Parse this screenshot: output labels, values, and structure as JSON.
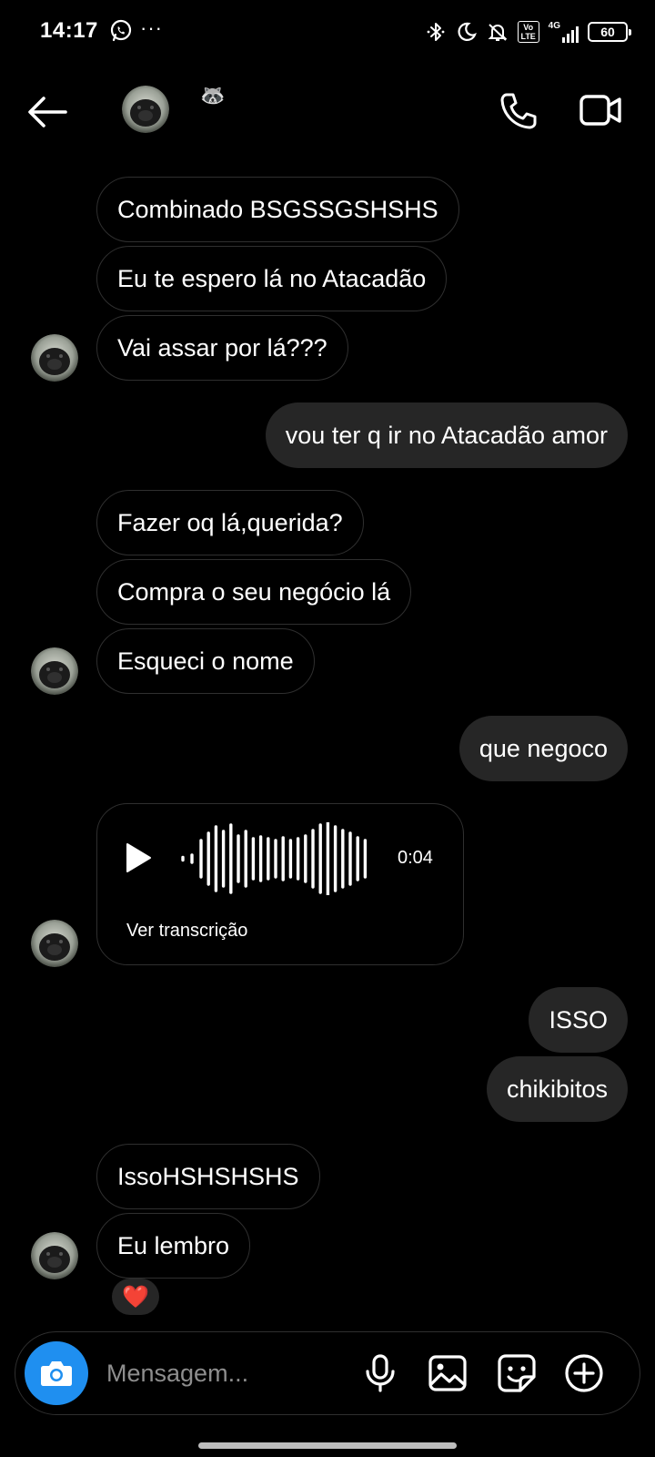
{
  "status_bar": {
    "time": "14:17",
    "icons": [
      "whatsapp-icon",
      "more-dots-icon",
      "bluetooth-icon",
      "moon-icon",
      "silent-icon",
      "volte-icon",
      "signal-4g-icon",
      "battery-icon"
    ],
    "more": "···",
    "volte": "Vo LTE",
    "network": "4G",
    "battery": "60"
  },
  "header": {
    "contact_emoji": "🦝",
    "icons": [
      "back-arrow-icon",
      "phone-icon",
      "video-camera-icon"
    ]
  },
  "messages": [
    {
      "side": "in",
      "text": "Combinado BSGSSGSHSHS"
    },
    {
      "side": "in",
      "text": "Eu te espero lá no Atacadão"
    },
    {
      "side": "in",
      "text": "Vai assar por lá???"
    },
    {
      "side": "out",
      "text": "vou ter q ir no Atacadão amor"
    },
    {
      "side": "in",
      "text": "Fazer oq lá,querida?"
    },
    {
      "side": "in",
      "text": "Compra o seu negócio lá"
    },
    {
      "side": "in",
      "text": "Esqueci o nome"
    },
    {
      "side": "out",
      "text": "que negoco"
    },
    {
      "side": "out",
      "text": "ISSO"
    },
    {
      "side": "out",
      "text": "chikibitos"
    },
    {
      "side": "in",
      "text": "IssoHSHSHSHS"
    },
    {
      "side": "in",
      "text": "Eu lembro"
    }
  ],
  "voice_message": {
    "duration": "0:04",
    "transcription_link": "Ver transcrição"
  },
  "reaction": "❤️",
  "composer": {
    "placeholder": "Mensagem...",
    "icons": [
      "camera-icon",
      "microphone-icon",
      "gallery-icon",
      "sticker-icon",
      "plus-icon"
    ]
  },
  "colors": {
    "background": "#000000",
    "outgoing_bubble": "#262626",
    "incoming_border": "#2f2f2f",
    "camera_button": "#1f8ff0",
    "heart": "#ff3040"
  }
}
